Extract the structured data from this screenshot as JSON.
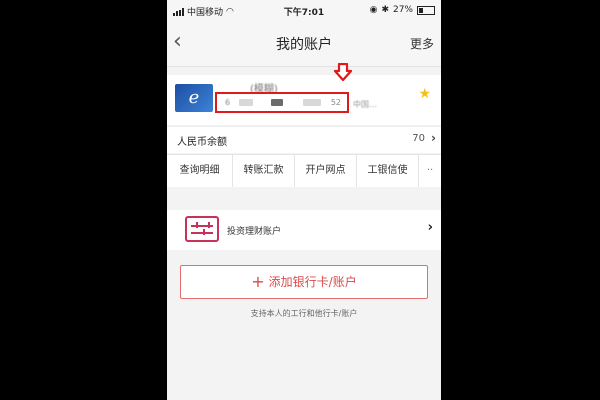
{
  "status_bar": {
    "carrier": "中国移动",
    "time": "下午7:01",
    "battery": "27%"
  },
  "nav": {
    "title": "我的账户",
    "more_label": "更多"
  },
  "account_card": {
    "name": "(模糊)",
    "number_prefix": "6",
    "number_suffix": "52",
    "branch": "中国…"
  },
  "balance": {
    "label": "人民币余额",
    "value": "70"
  },
  "actions": [
    {
      "label": "查询明细"
    },
    {
      "label": "转账汇款"
    },
    {
      "label": "开户网点"
    },
    {
      "label": "工银信使"
    },
    {
      "label": "··"
    }
  ],
  "invest": {
    "label": "投资理财账户"
  },
  "add_card": {
    "label": "添加银行卡/账户",
    "hint": "支持本人的工行和他行卡/账户"
  },
  "colors": {
    "accent_red": "#e01919",
    "button_red": "#d94b4b",
    "star": "#f2c21b",
    "invest_icon": "#c8325a"
  }
}
